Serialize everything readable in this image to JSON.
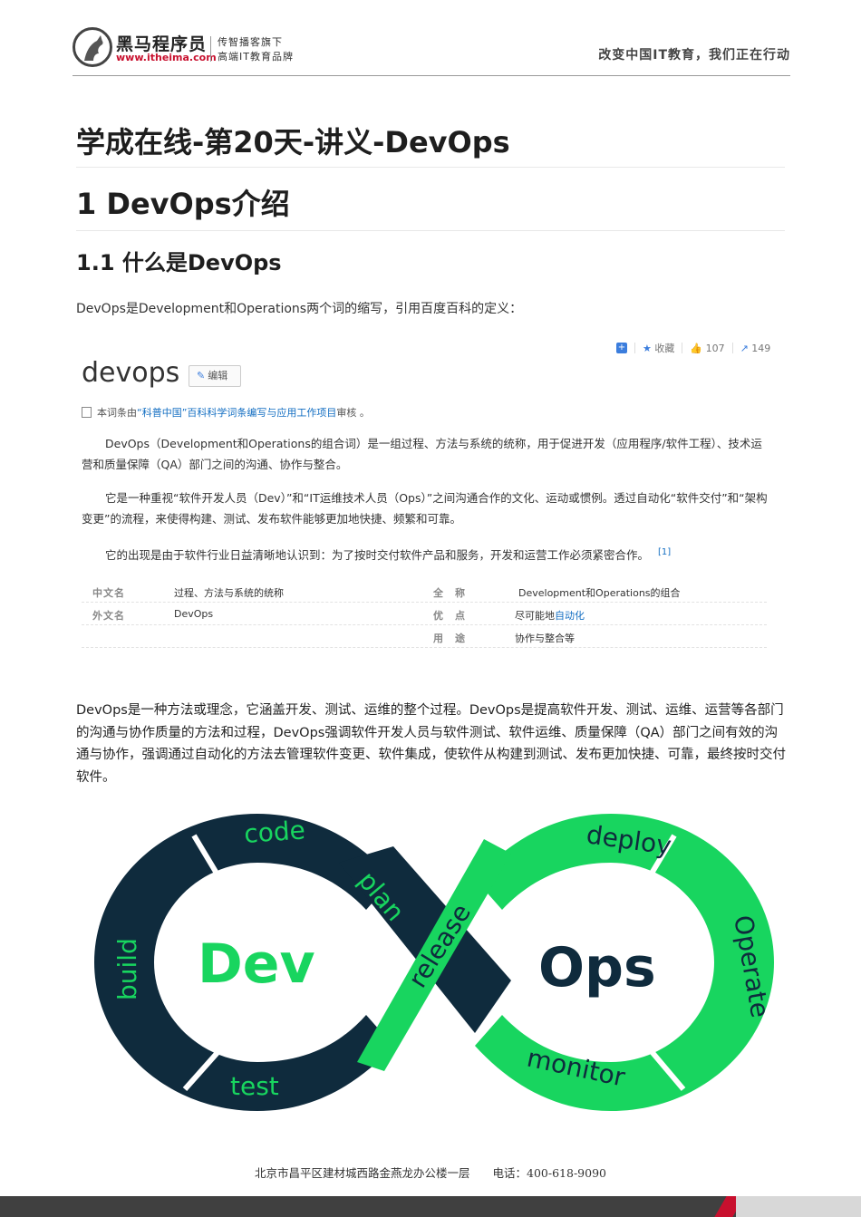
{
  "header": {
    "logo_name": "黑马程序员",
    "logo_url": "www.itheima.com",
    "tagline_1": "传智播客旗下",
    "tagline_2": "高端IT教育品牌",
    "slogan": "改变中国IT教育，我们正在行动"
  },
  "doc": {
    "title": "学成在线-第20天-讲义-DevOps",
    "section": "1 DevOps介绍",
    "subsection": "1.1 什么是DevOps",
    "intro": "DevOps是Development和Operations两个词的缩写，引用百度百科的定义：",
    "body": "DevOps是一种方法或理念，它涵盖开发、测试、运维的整个过程。DevOps是提高软件开发、测试、运维、运营等各部门的沟通与协作质量的方法和过程，DevOps强调软件开发人员与软件测试、软件运维、质量保障（QA）部门之间有效的沟通与协作，强调通过自动化的方法去管理软件变更、软件集成，使软件从构建到测试、发布更加快捷、可靠，最终按时交付软件。"
  },
  "baike": {
    "actions": {
      "collect": "收藏",
      "likes": "107",
      "shares": "149"
    },
    "title": "devops",
    "edit": "编辑",
    "review_prefix": "本词条由",
    "review_link": "“科普中国”百科科学词条编写与应用工作项目",
    "review_suffix": "审核 。",
    "para1": "DevOps（Development和Operations的组合词）是一组过程、方法与系统的统称，用于促进开发（应用程序/软件工程）、技术运营和质量保障（QA）部门之间的沟通、协作与整合。",
    "para2": "它是一种重视“软件开发人员（Dev）”和“IT运维技术人员（Ops）”之间沟通合作的文化、运动或惯例。透过自动化“软件交付”和“架构变更”的流程，来使得构建、测试、发布软件能够更加地快捷、频繁和可靠。",
    "para3": "它的出现是由于软件行业日益清晰地认识到：为了按时交付软件产品和服务，开发和运营工作必须紧密合作。",
    "para3_ref": "[1]",
    "info": {
      "k_cn": "中文名",
      "v_cn": "过程、方法与系统的统称",
      "k_full": "全　称",
      "v_full": "Development和Operations的组合",
      "k_en": "外文名",
      "v_en": "DevOps",
      "k_adv": "优　点",
      "v_adv_prefix": "尽可能地",
      "v_adv_link": "自动化",
      "k_use": "用　途",
      "v_use": "协作与整合等"
    }
  },
  "diagram": {
    "dev": "Dev",
    "ops": "Ops",
    "stages": [
      "code",
      "plan",
      "build",
      "test",
      "release",
      "deploy",
      "Operate",
      "monitor"
    ],
    "colors": {
      "dark": "#0f2b3d",
      "green": "#18d55f"
    }
  },
  "footer": {
    "address": "北京市昌平区建材城西路金燕龙办公楼一层　　电话：400-618-9090"
  }
}
